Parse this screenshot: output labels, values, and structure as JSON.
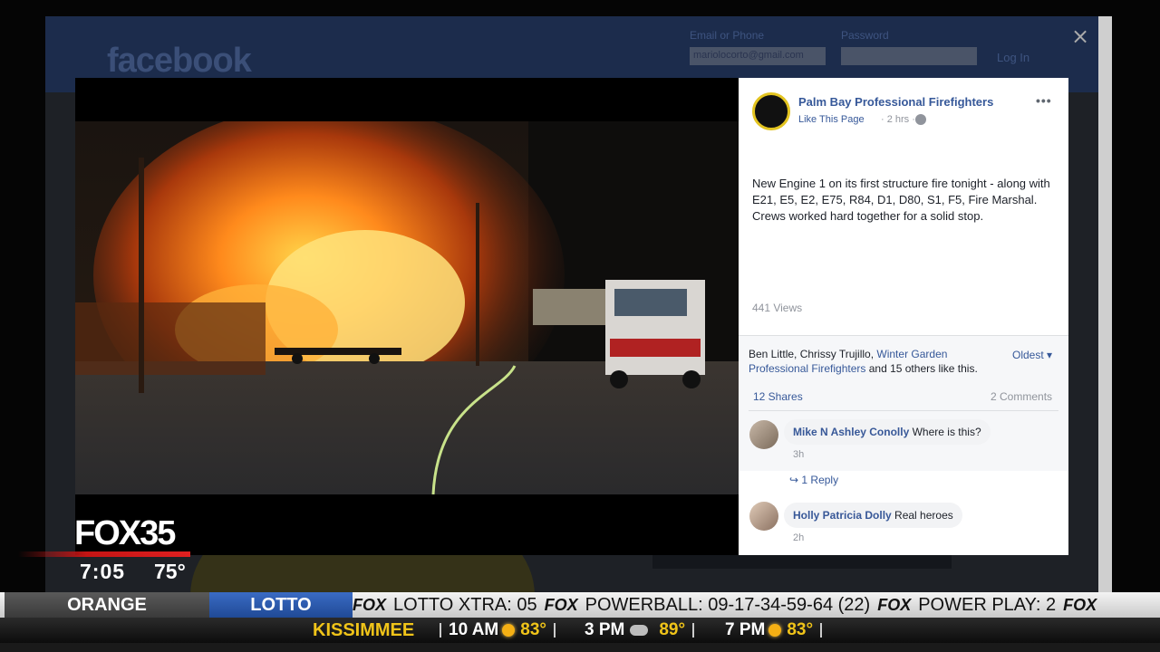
{
  "background_page": {
    "logo": "facebook",
    "email_label": "Email or Phone",
    "email_value": "mariolocorto@gmail.com",
    "password_label": "Password",
    "login_label": "Log In"
  },
  "viewer": {
    "close_glyph": "×"
  },
  "post": {
    "page_name": "Palm Bay Professional Firefighters",
    "like_page": "Like This Page",
    "time_ago": "· 2 hrs ·",
    "more": "•••",
    "text": "New Engine 1 on its first structure fire tonight - along with E21, E5, E2, E75, R84, D1, D80, S1, F5, Fire Marshal. Crews worked hard together for a solid stop.",
    "views": "441 Views",
    "likes_prefix": "Ben Little, Chrissy Trujillo, ",
    "likes_link": "Winter Garden Professional Firefighters",
    "likes_suffix": " and 15 others like this.",
    "sort": "Oldest ▾",
    "shares": "12 Shares",
    "comments_count": "2 Comments",
    "comments": [
      {
        "name": "Mike N Ashley Conolly",
        "text": "Where is this?",
        "time": "3h"
      },
      {
        "name": "Holly Patricia Dolly",
        "text": "Real heroes",
        "time": "2h"
      }
    ],
    "reply": "↪  1 Reply"
  },
  "broadcast": {
    "station": "FOX35",
    "time": "7:05",
    "temp": "75°",
    "ticker_label_1": "ORANGE",
    "ticker_label_2": "LOTTO",
    "ticker_items": [
      "LOTTO XTRA: 05",
      "POWERBALL: 09-17-34-59-64 (22)",
      "POWER PLAY: 2"
    ],
    "ticker_brand": "FOX",
    "city": "KISSIMMEE",
    "forecast": [
      {
        "time": "10 AM",
        "icon": "sun-icon",
        "temp": "83°"
      },
      {
        "time": "3 PM",
        "icon": "storm-icon",
        "temp": "89°"
      },
      {
        "time": "7 PM",
        "icon": "sun-icon",
        "temp": "83°"
      }
    ]
  }
}
